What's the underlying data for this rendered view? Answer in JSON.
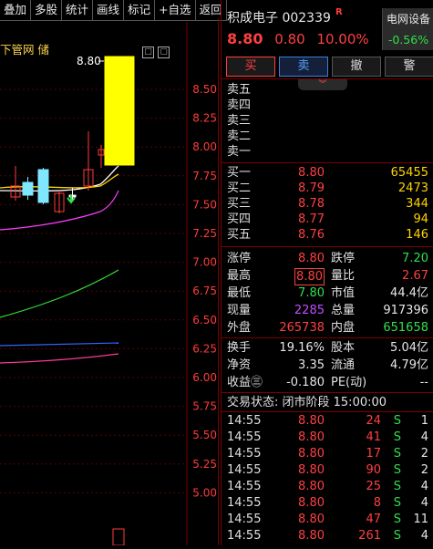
{
  "toolbar": [
    "叠加",
    "多股",
    "统计",
    "画线",
    "标记",
    "+自选",
    "返回"
  ],
  "chart": {
    "legend": "下管网 储",
    "high_label": "8.80",
    "y_ticks": [
      "8.50",
      "8.25",
      "8.00",
      "7.75",
      "7.50",
      "7.25",
      "7.00",
      "6.75",
      "6.50",
      "6.25",
      "6.00",
      "5.75",
      "5.50",
      "5.25",
      "5.00"
    ],
    "colors": {
      "up": "#ff3b3b",
      "limit": "#ffff00",
      "doji": "#7fe7ff",
      "ma5": "#ffffff",
      "ma10": "#ffd400",
      "ma20": "#ff3cff",
      "ma60": "#33dd33",
      "ma120": "#3366ff",
      "ma250": "#ff3c96"
    }
  },
  "stock": {
    "name": "积成电子",
    "code": "002339",
    "flag": "R",
    "price": "8.80",
    "change": "0.80",
    "change_pct": "10.00%",
    "sector_name": "电网设备",
    "sector_pct": "-0.56%"
  },
  "trade_buttons": [
    "买",
    "卖",
    "撤",
    "警"
  ],
  "sells": [
    {
      "label": "卖五",
      "price": "",
      "vol": ""
    },
    {
      "label": "卖四",
      "price": "",
      "vol": ""
    },
    {
      "label": "卖三",
      "price": "",
      "vol": ""
    },
    {
      "label": "卖二",
      "price": "",
      "vol": ""
    },
    {
      "label": "卖一",
      "price": "",
      "vol": ""
    }
  ],
  "buys": [
    {
      "label": "买一",
      "price": "8.80",
      "vol": "65455"
    },
    {
      "label": "买二",
      "price": "8.79",
      "vol": "2473"
    },
    {
      "label": "买三",
      "price": "8.78",
      "vol": "344"
    },
    {
      "label": "买四",
      "price": "8.77",
      "vol": "94"
    },
    {
      "label": "买五",
      "price": "8.76",
      "vol": "146"
    }
  ],
  "stats": {
    "limit_up_label": "涨停",
    "limit_up": "8.80",
    "limit_down_label": "跌停",
    "limit_down": "7.20",
    "high_label": "最高",
    "high": "8.80",
    "vol_ratio_label": "量比",
    "vol_ratio": "2.67",
    "low_label": "最低",
    "low": "7.80",
    "mkt_cap_label": "市值",
    "mkt_cap": "44.4亿",
    "now_vol_label": "现量",
    "now_vol": "2285",
    "total_vol_label": "总量",
    "total_vol": "917396",
    "outer_label": "外盘",
    "outer": "265738",
    "inner_label": "内盘",
    "inner": "651658",
    "turnover_label": "换手",
    "turnover": "19.16%",
    "equity_label": "股本",
    "equity": "5.04亿",
    "nav_label": "净资",
    "nav": "3.35",
    "float_label": "流通",
    "float": "4.79亿",
    "eps_label": "收益㊂",
    "eps": "-0.180",
    "pe_label": "PE(动)",
    "pe": "--"
  },
  "status": "交易状态: 闭市阶段 15:00:00",
  "ticks": [
    {
      "time": "14:55",
      "price": "8.80",
      "vol": "24",
      "side": "S",
      "n": "1"
    },
    {
      "time": "14:55",
      "price": "8.80",
      "vol": "41",
      "side": "S",
      "n": "4"
    },
    {
      "time": "14:55",
      "price": "8.80",
      "vol": "17",
      "side": "S",
      "n": "2"
    },
    {
      "time": "14:55",
      "price": "8.80",
      "vol": "90",
      "side": "S",
      "n": "2"
    },
    {
      "time": "14:55",
      "price": "8.80",
      "vol": "25",
      "side": "S",
      "n": "4"
    },
    {
      "time": "14:55",
      "price": "8.80",
      "vol": "8",
      "side": "S",
      "n": "4"
    },
    {
      "time": "14:55",
      "price": "8.80",
      "vol": "47",
      "side": "S",
      "n": "11"
    },
    {
      "time": "14:55",
      "price": "8.80",
      "vol": "261",
      "side": "S",
      "n": "4"
    }
  ]
}
